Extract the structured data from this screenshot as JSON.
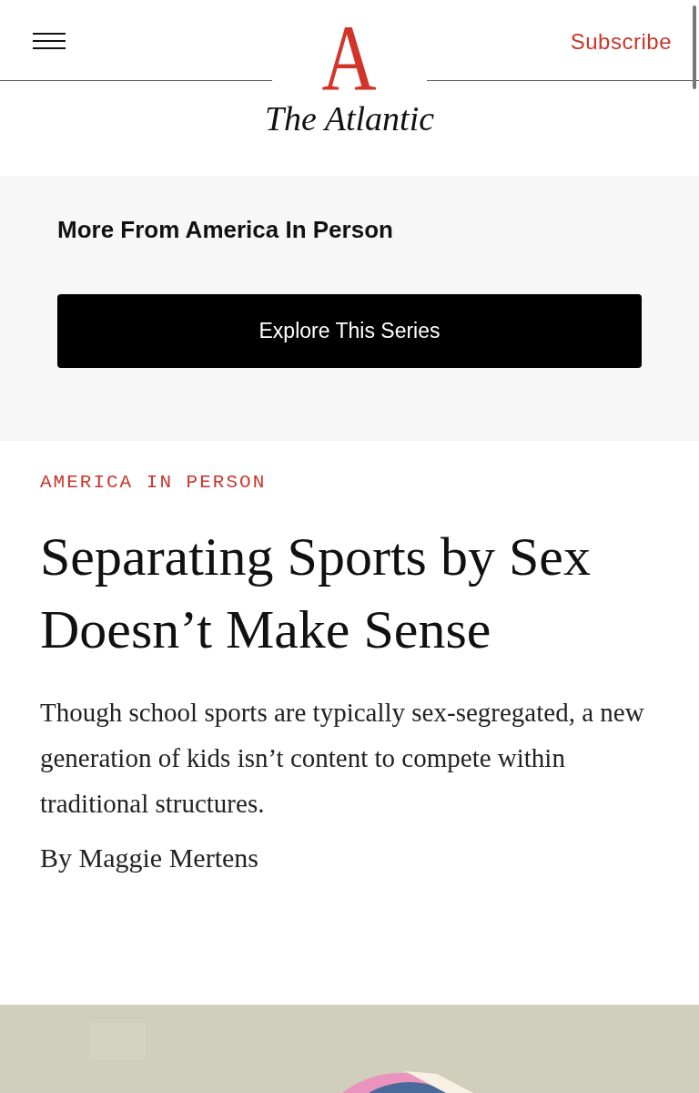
{
  "header": {
    "logo_letter": "A",
    "logo_name": "The Atlantic",
    "subscribe": "Subscribe"
  },
  "series_promo": {
    "title": "More From America In Person",
    "button": "Explore This Series"
  },
  "article": {
    "kicker": "AMERICA IN PERSON",
    "headline": "Separating Sports by Sex Doesn’t Make Sense",
    "dek": "Though school sports are typically sex-segregated, a new generation of kids isn’t content to compete within traditional structures.",
    "byline": "By Maggie Mertens"
  }
}
